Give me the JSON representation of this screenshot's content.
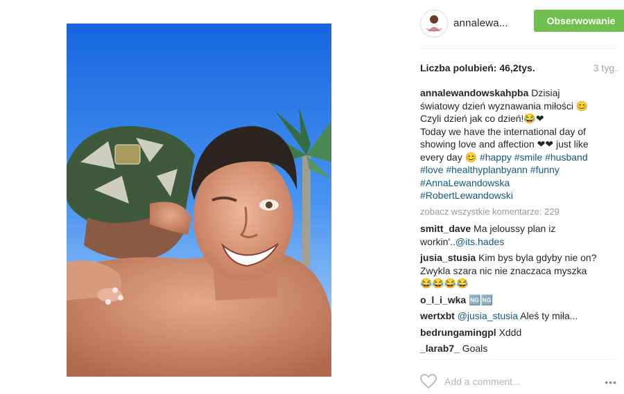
{
  "header": {
    "username": "annalewa...",
    "follow_label": "Obserwowanie"
  },
  "stats": {
    "likes_label": "Liczba polubień: 46,2tys.",
    "age": "3 tyg."
  },
  "caption": {
    "user": "annalewandowskahpba",
    "text_pl": "Dzisiaj światowy dzień wyznawania miłości 😊 Czyli dzień jak co dzień!😂❤",
    "text_en": "Today we have the international day of showing love and affection ❤❤ just like every day 😊 ",
    "hashtags": [
      "#happy",
      "#smile",
      "#husband",
      "#love",
      "#healthyplanbyann",
      "#funny",
      "#AnnaLewandowska",
      "#RobertLewandowski"
    ]
  },
  "view_all_comments": "zobacz wszystkie komentarze: 229",
  "comments": [
    {
      "user": "smitt_dave",
      "text": "Ma jeloussy plan iz workin'..",
      "mention": "@its.hades"
    },
    {
      "user": "jusia_stusia",
      "text": "Kim bys byla gdyby nie on? Zwykla szara nic nie znaczaca myszka 😂😂😂😂"
    },
    {
      "user": "o_l_i_wka",
      "text": "🆖🆖"
    },
    {
      "user": "wertxbt",
      "mention": "@jusia_stusia",
      "text": " Aleś ty miła..."
    },
    {
      "user": "bedrungamingpl",
      "text": "Xddd"
    },
    {
      "user": "_larab7_",
      "text": "Goals"
    }
  ],
  "comment_box": {
    "placeholder": "Add a comment..."
  },
  "more_label": "•••",
  "colors": {
    "follow_button": "#70c050",
    "hashtag": "#125688",
    "muted": "#999999"
  }
}
